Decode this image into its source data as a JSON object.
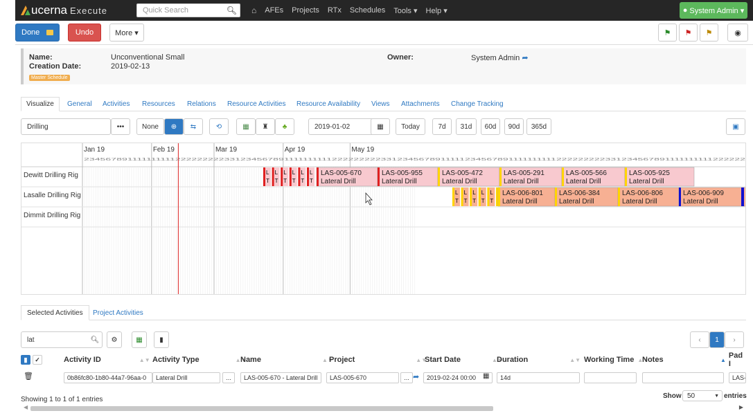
{
  "nav": {
    "logo_brand": "ucerna",
    "logo_product": "Execute",
    "search_placeholder": "Quick Search",
    "links": [
      "AFEs",
      "Projects",
      "RTx",
      "Schedules",
      "Tools ▾",
      "Help ▾"
    ],
    "admin": "System Admin ▾"
  },
  "toolbar": {
    "done": "Done",
    "undo": "Undo",
    "more": "More ▾"
  },
  "info": {
    "name_label": "Name:",
    "name": "Unconventional Small",
    "date_label": "Creation Date:",
    "date": "2019-02-13",
    "owner_label": "Owner:",
    "owner": "System Admin",
    "badge": "Master Schedule"
  },
  "tabs": [
    "Visualize",
    "General",
    "Activities",
    "Resources",
    "Relations",
    "Resource Activities",
    "Resource Availability",
    "Views",
    "Attachments",
    "Change Tracking"
  ],
  "controls": {
    "filter": "Drilling",
    "dots": "•••",
    "none": "None",
    "date": "2019-01-02",
    "today": "Today",
    "ranges": [
      "7d",
      "31d",
      "60d",
      "90d",
      "365d"
    ]
  },
  "gantt": {
    "months": [
      "Jan 19",
      "Feb 19",
      "Mar 19",
      "Apr 19",
      "May 19"
    ],
    "rigs": [
      "Dewitt Drilling Rig",
      "Lasalle Drilling Rig",
      "Dimmit Drilling Rig"
    ],
    "day_digits_label": "2345678911111111112222222223312345678911111111112222222223312345678911111",
    "bars": [
      {
        "row": 0,
        "label": "LAS-005-670",
        "sub": "Lateral Drill",
        "color": "#f8c9cf",
        "edge": "#e02020"
      },
      {
        "row": 0,
        "label": "LAS-005-955",
        "sub": "Lateral Drill",
        "color": "#f8c9cf",
        "edge": "#e02020"
      },
      {
        "row": 0,
        "label": "LAS-005-472",
        "sub": "Lateral Drill",
        "color": "#f8c9cf",
        "edge": "#ffd400"
      },
      {
        "row": 0,
        "label": "LAS-005-291",
        "sub": "Lateral Drill",
        "color": "#f8c9cf",
        "edge": "#ffd400"
      },
      {
        "row": 0,
        "label": "LAS-005-566",
        "sub": "Lateral Drill",
        "color": "#f8c9cf",
        "edge": "#ffd400"
      },
      {
        "row": 0,
        "label": "LAS-005-925",
        "sub": "Lateral Drill",
        "color": "#f8c9cf",
        "edge": "#ffd400"
      },
      {
        "row": 1,
        "label": "LAS-006-801",
        "sub": "Lateral Drill",
        "color": "#f7b093",
        "edge": "#ffd400"
      },
      {
        "row": 1,
        "label": "LAS-006-384",
        "sub": "Lateral Drill",
        "color": "#f7b093",
        "edge": "#ffd400"
      },
      {
        "row": 1,
        "label": "LAS-006-806",
        "sub": "Lateral Drill",
        "color": "#f7b093",
        "edge": "#ffd400"
      },
      {
        "row": 1,
        "label": "LAS-006-909",
        "sub": "Lateral Drill",
        "color": "#f7b093",
        "edge": "#1010d0"
      }
    ],
    "mini_labels": [
      "L",
      "T"
    ]
  },
  "btabs": [
    "Selected Activities",
    "Project Activities"
  ],
  "filter": {
    "value": "lat",
    "page": "1"
  },
  "table": {
    "headers": [
      "Activity ID",
      "Activity Type",
      "Name",
      "Project",
      "Start Date",
      "Duration",
      "Working Time",
      "Notes",
      "Pad I"
    ],
    "row": {
      "id": "0b86fc80-1b80-44a7-96aa-0",
      "type": "Lateral Drill",
      "name": "LAS-005-670 - Lateral Drill",
      "project": "LAS-005-670",
      "start": "2019-02-24 00:00",
      "duration": "14d",
      "working": "",
      "notes": "",
      "pad": "LAS-"
    },
    "dots": "..."
  },
  "footer": {
    "showing": "Showing 1 to 1 of 1 entries",
    "show": "Show",
    "show_val": "50",
    "entries": "entries"
  }
}
